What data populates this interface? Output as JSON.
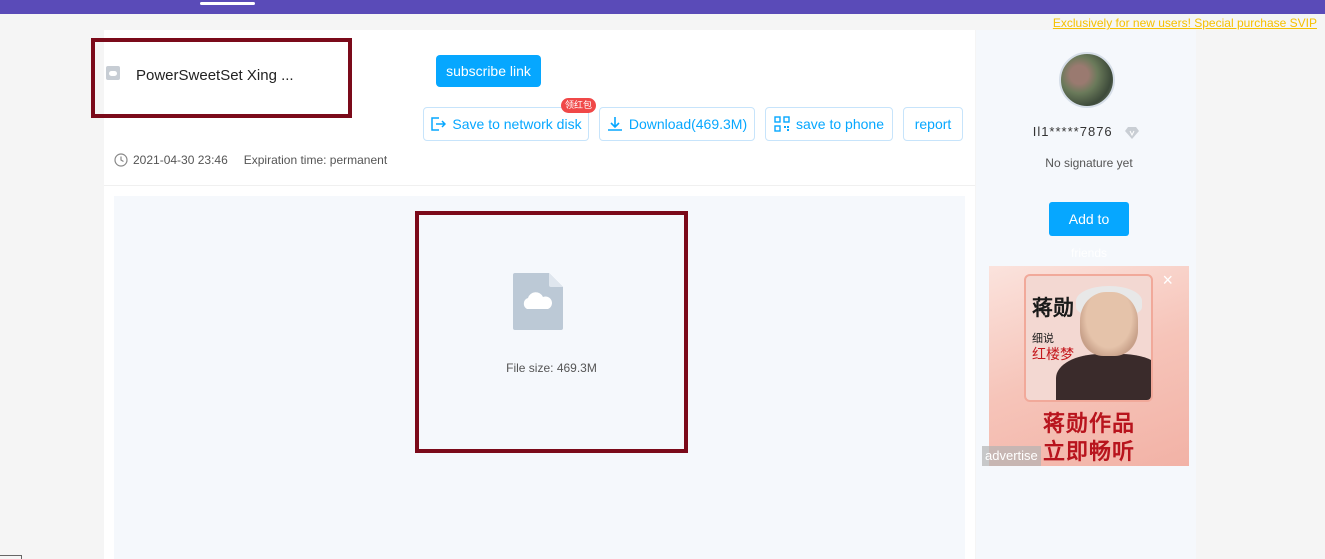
{
  "promo": {
    "text": "Exclusively for new users! Special purchase SVIP"
  },
  "file": {
    "title": "PowerSweetSet Xing ...",
    "date": "2021-04-30 23:46",
    "expiration": "Expiration time: permanent",
    "size_text": "File size: 469.3M"
  },
  "buttons": {
    "subscribe": "subscribe link",
    "save_network": "Save to network disk",
    "download": "Download(469.3M)",
    "save_phone": "save to phone",
    "report": "report",
    "badge": "领红包"
  },
  "sidebar": {
    "username": "Il1*****7876",
    "signature": "No signature yet",
    "add_button": "Add to",
    "friends": "friends"
  },
  "ad": {
    "title_main": "蒋勋",
    "title_sub": "细说",
    "title_book": "红楼梦",
    "line1": "蒋勋作品",
    "line2": "立即畅听",
    "label": "advertise",
    "close": "×"
  },
  "colors": {
    "accent": "#06a7ff",
    "topbar": "#5a4bb8",
    "highlight_border": "#7b0a1a",
    "promo": "#f5c100"
  }
}
